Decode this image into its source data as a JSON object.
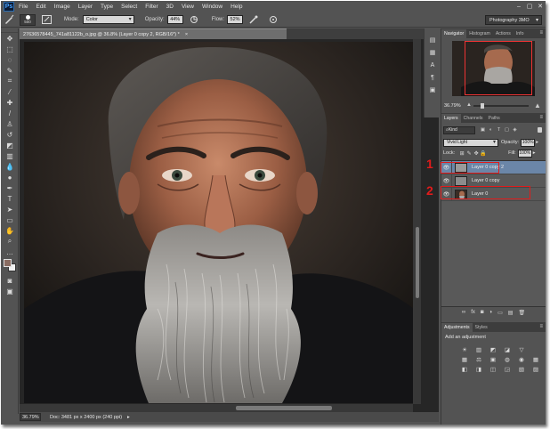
{
  "app": {
    "logo": "Ps"
  },
  "menu": [
    "File",
    "Edit",
    "Image",
    "Layer",
    "Type",
    "Select",
    "Filter",
    "3D",
    "View",
    "Window",
    "Help"
  ],
  "window_controls": [
    "–",
    "▢",
    "✕"
  ],
  "options_bar": {
    "brush_size": "500",
    "mode_label": "Mode:",
    "mode_value": "Color",
    "opacity_label": "Opacity:",
    "opacity_value": "44%",
    "flow_label": "Flow:",
    "flow_value": "52%",
    "workspace": "Photography 3MO"
  },
  "document": {
    "tab_title": "27636578445_741a81122b_o.jpg @ 36.8% (Layer 0 copy 2, RGB/16*) *",
    "close": "×",
    "zoom": "36.79%",
    "status": "Doc: 3481 px x 2400 px (240 ppi)",
    "status_arrow": "▸"
  },
  "navigator": {
    "tabs": [
      "Navigator",
      "Histogram",
      "Actions",
      "Info"
    ],
    "zoom": "36.79%"
  },
  "layers_panel": {
    "tabs": [
      "Layers",
      "Channels",
      "Paths"
    ],
    "filter_kind": "Kind",
    "filter_icons": [
      "▣",
      "◐",
      "T",
      "▢",
      "◈"
    ],
    "blend_mode": "Vivid Light",
    "opacity_label": "Opacity:",
    "opacity_value": "100%",
    "lock_label": "Lock:",
    "lock_icons": [
      "⊞",
      "✎",
      "✥",
      "🔒"
    ],
    "fill_label": "Fill:",
    "fill_value": "100%",
    "layers": [
      {
        "name": "Layer 0 copy 2",
        "selected": true
      },
      {
        "name": "Layer 0 copy",
        "selected": false
      },
      {
        "name": "Layer 0",
        "selected": false
      }
    ],
    "footer_icons": [
      "∞",
      "fx",
      "◙",
      "◑",
      "▭",
      "▤",
      "🗑"
    ]
  },
  "adjustments": {
    "tabs": [
      "Adjustments",
      "Styles"
    ],
    "title": "Add an adjustment",
    "icons": [
      "☀",
      "▥",
      "◩",
      "◪",
      "▽",
      "",
      "▦",
      "⚖",
      "▣",
      "◍",
      "◉",
      "▦",
      "◧",
      "◨",
      "◫",
      "◲",
      "▧",
      "▨"
    ]
  },
  "annotations": {
    "one": "1",
    "two": "2",
    "color": "#e11b1b"
  },
  "colors": {
    "accent_selected_layer": "#6b86a8",
    "ui_bg": "#535353",
    "foreground": "#8a6c62",
    "background": "#f2f2f2"
  }
}
